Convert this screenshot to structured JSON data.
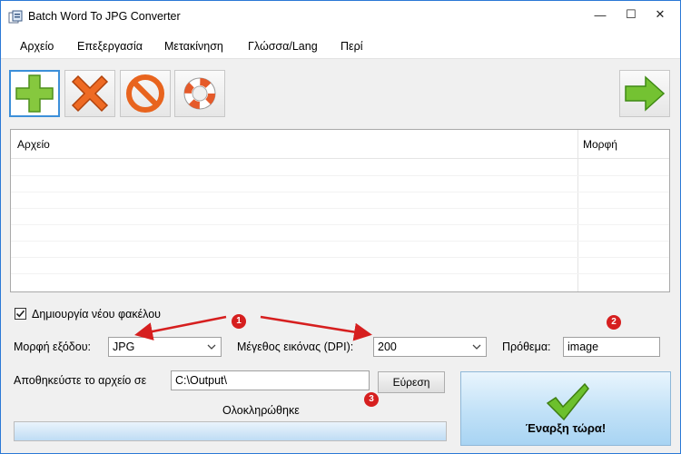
{
  "window": {
    "title": "Batch Word To JPG Converter",
    "controls": {
      "minimize": "—",
      "maximize": "☐",
      "close": "✕"
    }
  },
  "menu": [
    "Αρχείο",
    "Επεξεργασία",
    "Μετακίνηση",
    "Γλώσσα/Lang",
    "Περί"
  ],
  "toolbar": {
    "buttons": [
      {
        "name": "add",
        "icon": "plus-icon",
        "color": "#7cc33a"
      },
      {
        "name": "remove",
        "icon": "x-icon",
        "color": "#e8641e"
      },
      {
        "name": "clear",
        "icon": "no-entry-icon",
        "color": "#e8641e"
      },
      {
        "name": "help",
        "icon": "lifebuoy-icon",
        "color": "#e55a2a"
      }
    ],
    "next": {
      "icon": "arrow-right-icon",
      "color": "#6fbf2f"
    }
  },
  "file_list": {
    "columns": [
      "Αρχείο",
      "Μορφή"
    ],
    "rows": []
  },
  "options": {
    "create_folder": {
      "label": "Δημιουργία νέου φακέλου",
      "checked": true
    },
    "output_format": {
      "label": "Μορφή εξόδου:",
      "value": "JPG"
    },
    "image_size": {
      "label": "Μέγεθος εικόνας (DPI):",
      "value": "200"
    },
    "prefix": {
      "label": "Πρόθεμα:",
      "value": "image"
    },
    "save_path": {
      "label": "Αποθηκεύστε το αρχείο σε",
      "value": "C:\\Output\\"
    },
    "browse_label": "Εύρεση"
  },
  "status": {
    "text": "Ολοκληρώθηκε",
    "progress_percent": 100
  },
  "start_button": {
    "label": "Έναρξη τώρα!"
  },
  "annotations": {
    "badges": [
      "1",
      "2",
      "3"
    ],
    "color": "#d61f1f"
  }
}
